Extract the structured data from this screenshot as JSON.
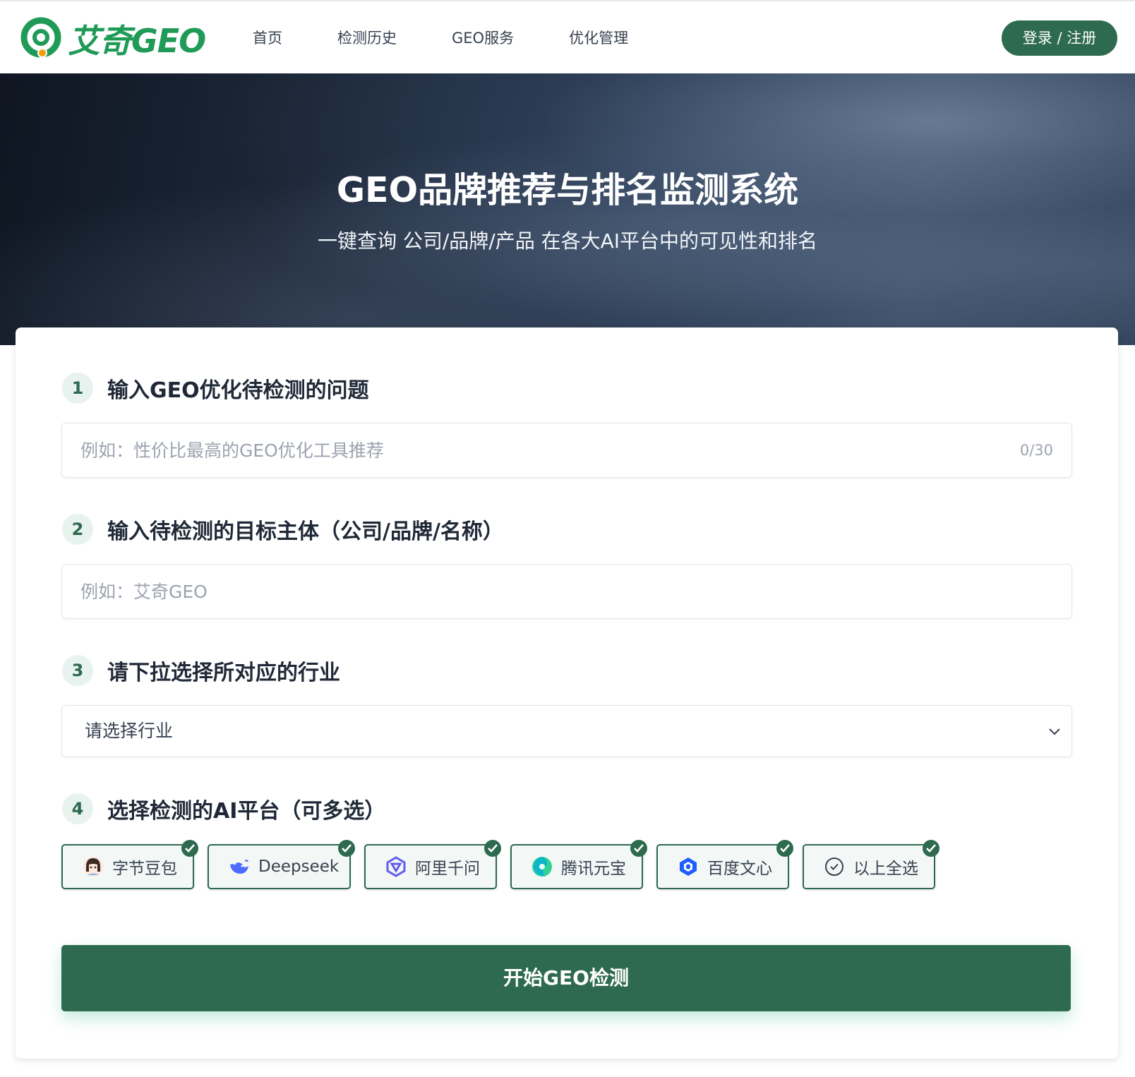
{
  "brand": {
    "logo_text": "艾奇GEO",
    "color": "#1f9a57"
  },
  "nav": {
    "items": [
      "首页",
      "检测历史",
      "GEO服务",
      "优化管理"
    ],
    "login_label": "登录 / 注册"
  },
  "hero": {
    "title": "GEO品牌推荐与排名监测系统",
    "subtitle": "一键查询 公司/品牌/产品 在各大AI平台中的可见性和排名"
  },
  "form": {
    "step1": {
      "number": "1",
      "title": "输入GEO优化待检测的问题",
      "placeholder": "例如：性价比最高的GEO优化工具推荐",
      "counter": "0/30"
    },
    "step2": {
      "number": "2",
      "title": "输入待检测的目标主体（公司/品牌/名称）",
      "placeholder": "例如：艾奇GEO"
    },
    "step3": {
      "number": "3",
      "title": "请下拉选择所对应的行业",
      "selected": "请选择行业"
    },
    "step4": {
      "number": "4",
      "title": "选择检测的AI平台（可多选）",
      "platforms": [
        {
          "label": "字节豆包",
          "icon": "doubao-icon",
          "checked": true
        },
        {
          "label": "Deepseek",
          "icon": "deepseek-icon",
          "checked": true
        },
        {
          "label": "阿里千问",
          "icon": "qianwen-icon",
          "checked": true
        },
        {
          "label": "腾讯元宝",
          "icon": "yuanbao-icon",
          "checked": true
        },
        {
          "label": "百度文心",
          "icon": "wenxin-icon",
          "checked": true
        },
        {
          "label": "以上全选",
          "icon": "check-circle-icon",
          "checked": true
        }
      ]
    },
    "submit_label": "开始GEO检测"
  },
  "colors": {
    "primary": "#2d6a4f",
    "step_badge_bg": "#e8f2ee"
  }
}
